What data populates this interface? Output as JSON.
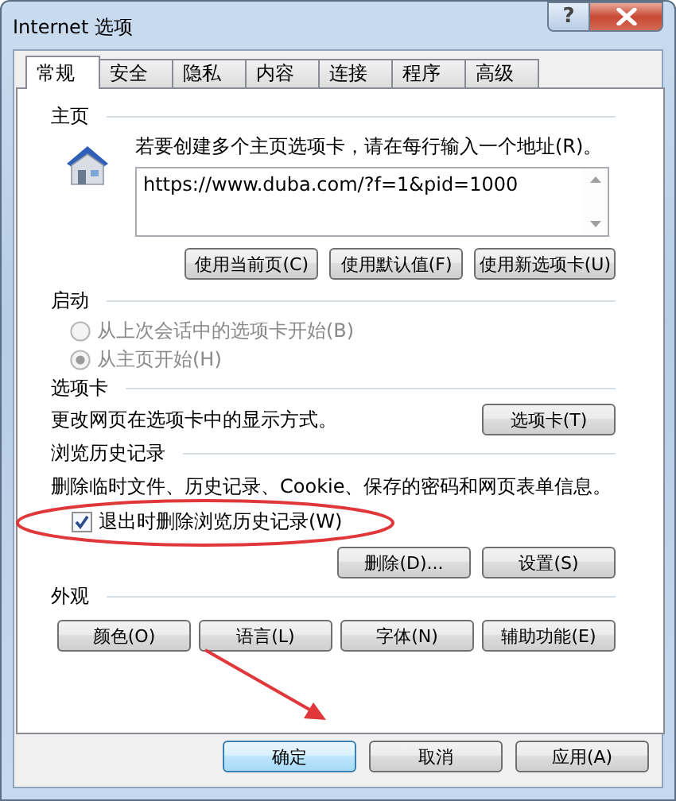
{
  "window": {
    "title": "Internet 选项",
    "help": "?"
  },
  "tabs": [
    {
      "label": "常规",
      "selected": true
    },
    {
      "label": "安全",
      "selected": false
    },
    {
      "label": "隐私",
      "selected": false
    },
    {
      "label": "内容",
      "selected": false
    },
    {
      "label": "连接",
      "selected": false
    },
    {
      "label": "程序",
      "selected": false
    },
    {
      "label": "高级",
      "selected": false
    }
  ],
  "homepage": {
    "title": "主页",
    "description": "若要创建多个主页选项卡，请在每行输入一个地址(R)。",
    "url": "https://www.duba.com/?f=1&pid=1000",
    "buttons": [
      "使用当前页(C)",
      "使用默认值(F)",
      "使用新选项卡(U)"
    ]
  },
  "startup": {
    "title": "启动",
    "options": [
      {
        "label": "从上次会话中的选项卡开始(B)",
        "selected": false,
        "disabled": true
      },
      {
        "label": "从主页开始(H)",
        "selected": true,
        "disabled": true
      }
    ]
  },
  "tabs_section": {
    "title": "选项卡",
    "description": "更改网页在选项卡中的显示方式。",
    "button": "选项卡(T)"
  },
  "history": {
    "title": "浏览历史记录",
    "description": "删除临时文件、历史记录、Cookie、保存的密码和网页表单信息。",
    "checkbox": {
      "label": "退出时删除浏览历史记录(W)",
      "checked": true
    },
    "buttons": [
      "删除(D)...",
      "设置(S)"
    ]
  },
  "appearance": {
    "title": "外观",
    "buttons": [
      "颜色(O)",
      "语言(L)",
      "字体(N)",
      "辅助功能(E)"
    ]
  },
  "footer": [
    {
      "label": "确定",
      "default": true
    },
    {
      "label": "取消",
      "default": false
    },
    {
      "label": "应用(A)",
      "default": false
    }
  ]
}
